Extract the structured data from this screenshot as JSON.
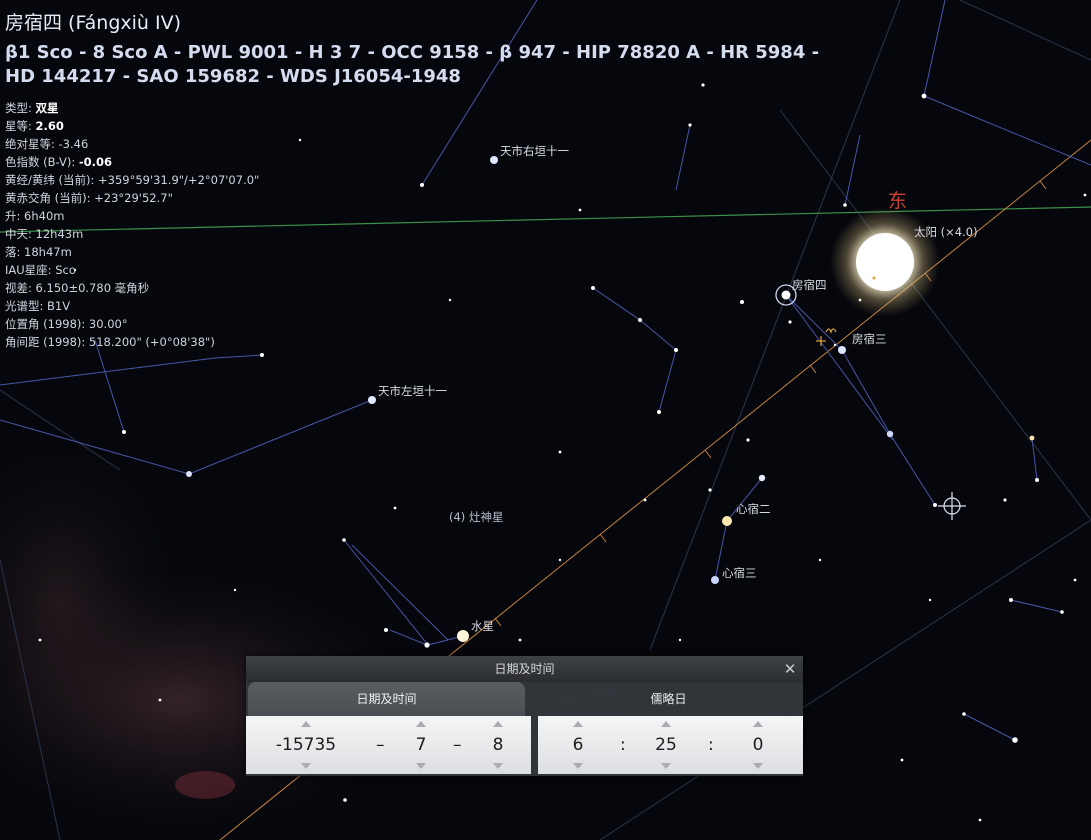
{
  "object": {
    "title": "房宿四 (Fángxiù IV)",
    "designations": "β1 Sco - 8 Sco A - PWL 9001 - H 3 7 - OCC 9158 - β 947 - HIP 78820 A - HR 5984 - HD 144217 - SAO 159682 - WDS J16054-1948",
    "type_label": "类型: ",
    "type_value": "双星",
    "mag_label": "星等: ",
    "mag_value": "2.60",
    "absmag": "绝对星等: -3.46",
    "color_label": "色指数 (B-V): ",
    "color_value": "-0.06",
    "ecl_coords": "黄经/黄纬 (当前): +359°59'31.9\"/+2°07'07.0\"",
    "obliquity": "黄赤交角 (当前): +23°29'52.7\"",
    "rise": "升: 6h40m",
    "transit": "中天: 12h43m",
    "set": "落: 18h47m",
    "iau": "IAU星座: Sco",
    "parallax": "视差: 6.150±0.780 毫角秒",
    "spectral": "光谱型: B1V",
    "pos_angle": "位置角 (1998): 30.00°",
    "separation": "角间距 (1998): 518.200\" (+0°08'38\")"
  },
  "sky_labels": {
    "east": "东",
    "sun": "太阳 (×4.0)",
    "fang4": "房宿四",
    "fang3": "房宿三",
    "xin2": "心宿二",
    "xin3": "心宿三",
    "tianshi_right": "天市右垣十一",
    "tianshi_left": "天市左垣十一",
    "vesta": "(4) 灶神星",
    "mercury": "水星"
  },
  "dialog": {
    "title": "日期及时间",
    "close": "✕",
    "tab_datetime": "日期及时间",
    "tab_julian": "儒略日",
    "year": "-15735",
    "month": "7",
    "day": "8",
    "hour": "6",
    "minute": "25",
    "second": "0",
    "date_sep": "–",
    "time_sep": ":"
  },
  "colors": {
    "ecliptic": "#c8823c",
    "horizon": "#3f8f4a",
    "constellation_lines": "#4f5fb8",
    "direction": "#cc4433"
  }
}
